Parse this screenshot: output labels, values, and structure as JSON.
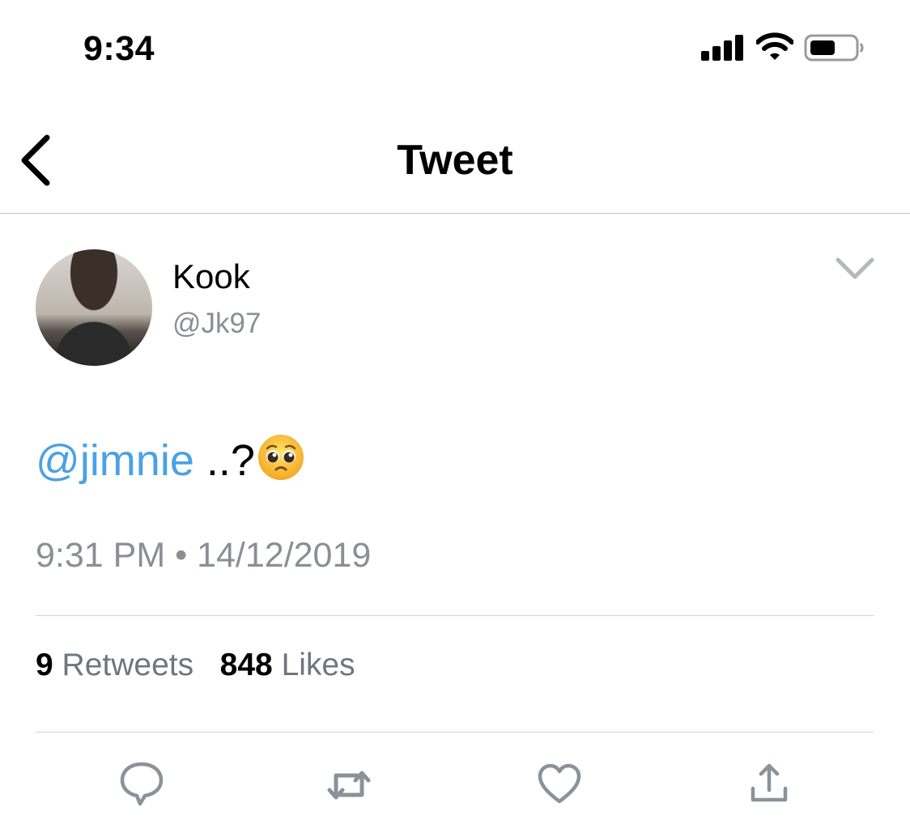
{
  "status_bar": {
    "time": "9:34",
    "icons": [
      "cellular-signal-icon",
      "wifi-icon",
      "battery-icon"
    ]
  },
  "nav": {
    "title": "Tweet",
    "back_icon": "chevron-left-icon"
  },
  "tweet": {
    "author": {
      "display_name": "Kook",
      "handle": "@Jk97"
    },
    "text": {
      "mention": "@jimnie",
      "rest": " ..?",
      "emoji": "pleading-face-emoji"
    },
    "timestamp": "9:31 PM • 14/12/2019",
    "stats": {
      "retweets_count": "9",
      "retweets_label": "Retweets",
      "likes_count": "848",
      "likes_label": "Likes"
    },
    "actions": [
      "reply-icon",
      "retweet-icon",
      "like-icon",
      "share-icon"
    ]
  },
  "colors": {
    "link": "#4aa1e6",
    "secondary_text": "#8a8f95",
    "icon_gray": "#8a9299",
    "divider": "#cfd3d6"
  }
}
